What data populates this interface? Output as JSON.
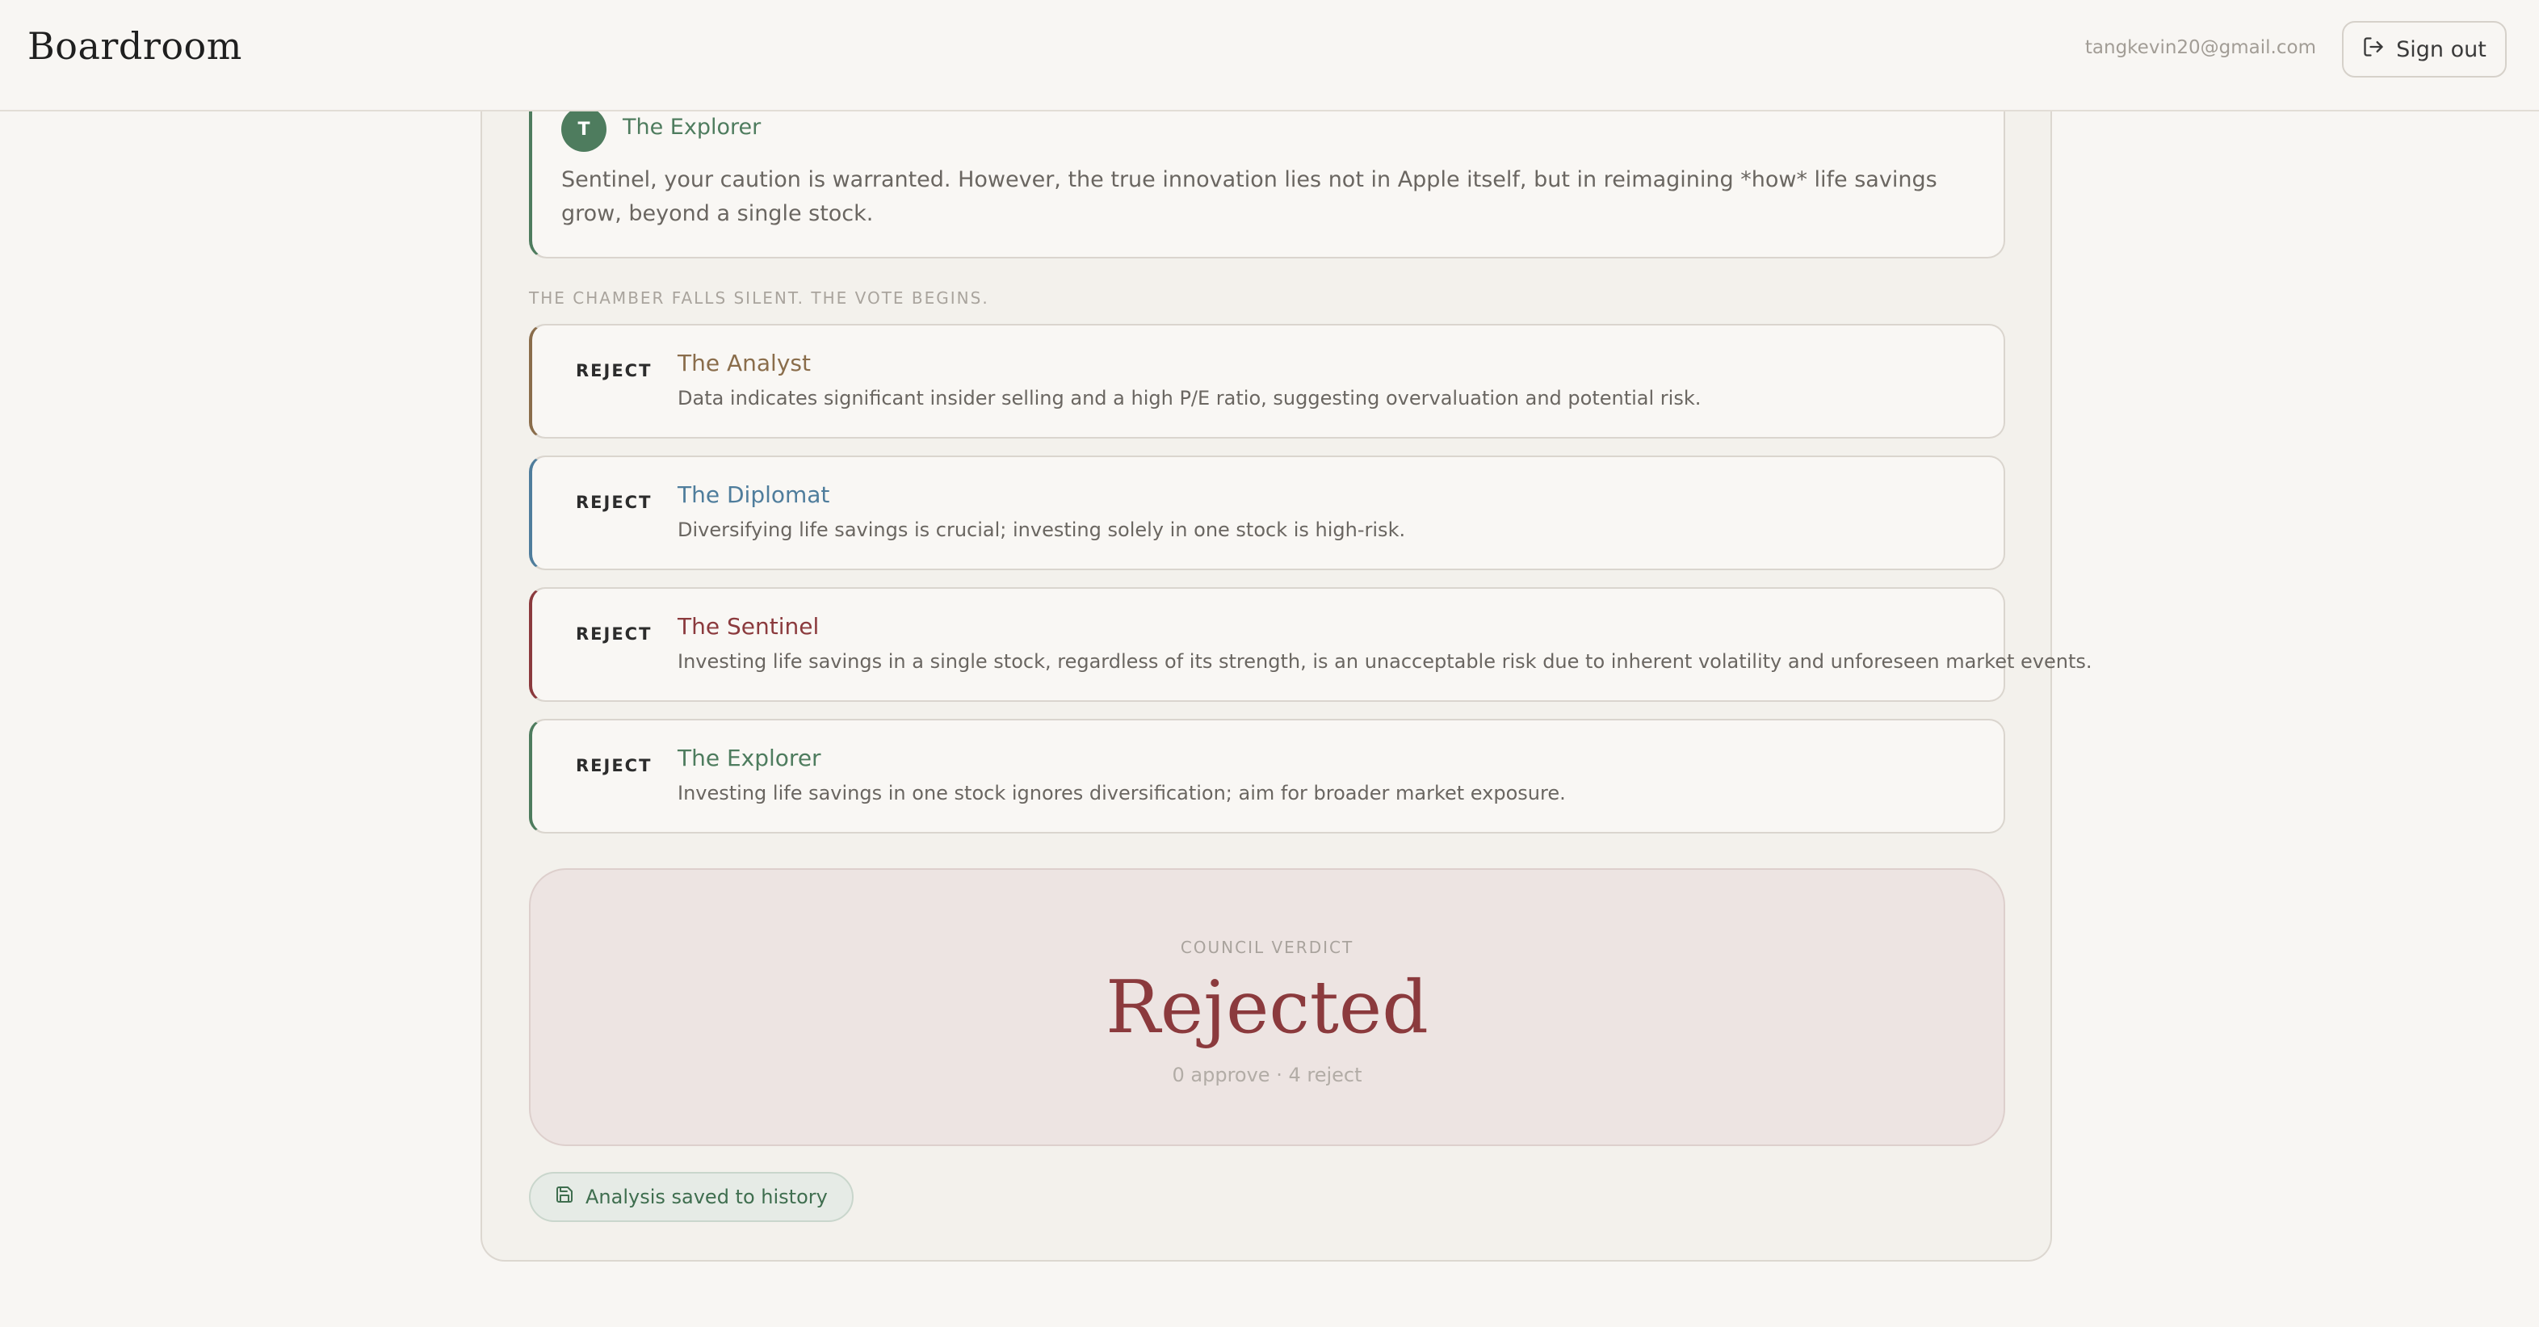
{
  "header": {
    "app_title": "Boardroom",
    "user_email": "tangkevin20@gmail.com",
    "signout_label": "Sign out",
    "signout_icon": "log-out-icon"
  },
  "message": {
    "avatar_letter": "T",
    "speaker": "The Explorer",
    "speaker_color": "#4e7c5e",
    "text": "Sentinel, your caution is warranted. However, the true innovation lies not in Apple itself, but in reimagining *how* life savings grow, beyond a single stock."
  },
  "vote": {
    "caption": "THE CHAMBER FALLS SILENT. THE VOTE BEGINS.",
    "cards": [
      {
        "badge": "REJECT",
        "name": "The Analyst",
        "color": "#8a6d4b",
        "reason": "Data indicates significant insider selling and a high P/E ratio, suggesting overvaluation and potential risk."
      },
      {
        "badge": "REJECT",
        "name": "The Diplomat",
        "color": "#4f7d9c",
        "reason": "Diversifying life savings is crucial; investing solely in one stock is high-risk."
      },
      {
        "badge": "REJECT",
        "name": "The Sentinel",
        "color": "#8b3a3d",
        "reason": "Investing life savings in a single stock, regardless of its strength, is an unacceptable risk due to inherent volatility and unforeseen market events."
      },
      {
        "badge": "REJECT",
        "name": "The Explorer",
        "color": "#4e7c5e",
        "reason": "Investing life savings in one stock ignores diversification; aim for broader market exposure."
      }
    ]
  },
  "verdict": {
    "label": "COUNCIL VERDICT",
    "result": "Rejected",
    "tally": "0 approve · 4 reject",
    "color": "#8b3a3d"
  },
  "saved": {
    "label": "Analysis saved to history",
    "icon": "save-icon"
  }
}
